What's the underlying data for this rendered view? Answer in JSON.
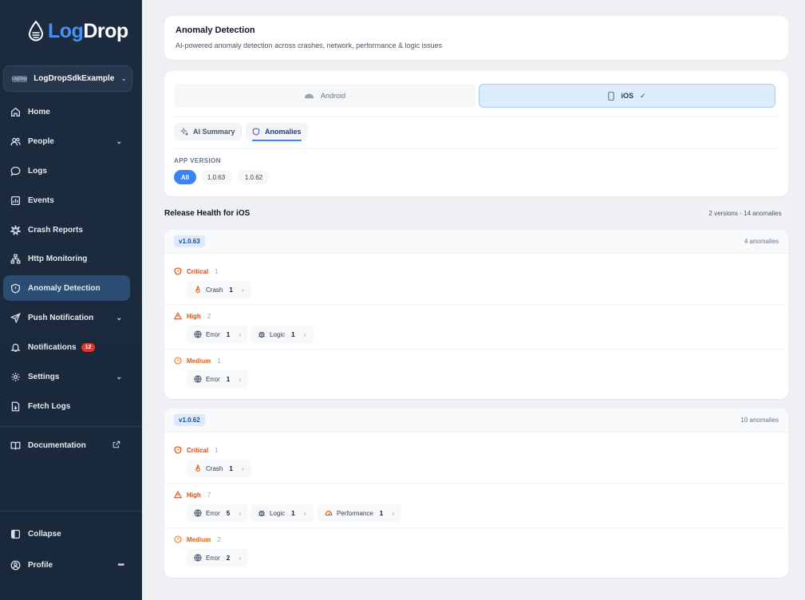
{
  "brand": {
    "part1": "Log",
    "part2": "Drop"
  },
  "project": {
    "icon_text": "LogDrop",
    "name": "LogDropSdkExample"
  },
  "nav": {
    "home": "Home",
    "people": "People",
    "logs": "Logs",
    "events": "Events",
    "crash_reports": "Crash Reports",
    "http_monitoring": "Http Monitoring",
    "anomaly_detection": "Anomaly Detection",
    "push_notification": "Push Notification",
    "notifications": "Notifications",
    "notifications_badge": "12",
    "settings": "Settings",
    "fetch_logs": "Fetch Logs",
    "documentation": "Documentation",
    "collapse": "Collapse",
    "profile": "Profile",
    "more": "•••"
  },
  "header": {
    "title": "Anomaly Detection",
    "subtitle": "AI-powered anomaly detection across crashes, network, performance & logic issues"
  },
  "platforms": {
    "android": "Android",
    "ios": "iOS",
    "ios_check": "✓"
  },
  "tabs": {
    "ai_summary": "AI Summary",
    "anomalies": "Anomalies"
  },
  "app_version": {
    "label": "APP VERSION",
    "options": [
      "All",
      "1.0.63",
      "1.0.62"
    ],
    "selected": "All"
  },
  "release_health": {
    "title": "Release Health for iOS",
    "summary": "2 versions · 14 anomalies"
  },
  "versions": [
    {
      "tag": "v1.0.63",
      "count": "4 anomalies",
      "critical": {
        "label": "Critical",
        "n": "1",
        "items": [
          {
            "label": "Crash",
            "count": "1"
          }
        ]
      },
      "high": {
        "label": "High",
        "n": "2",
        "items": [
          {
            "label": "Error",
            "count": "1"
          },
          {
            "label": "Logic",
            "count": "1"
          }
        ]
      },
      "medium": {
        "label": "Medium",
        "n": "1",
        "items": [
          {
            "label": "Error",
            "count": "1"
          }
        ]
      }
    },
    {
      "tag": "v1.0.62",
      "count": "10 anomalies",
      "critical": {
        "label": "Critical",
        "n": "1",
        "items": [
          {
            "label": "Crash",
            "count": "1"
          }
        ]
      },
      "high": {
        "label": "High",
        "n": "7",
        "items": [
          {
            "label": "Error",
            "count": "5"
          },
          {
            "label": "Logic",
            "count": "1"
          },
          {
            "label": "Performance",
            "count": "1"
          }
        ]
      },
      "medium": {
        "label": "Medium",
        "n": "2",
        "items": [
          {
            "label": "Error",
            "count": "2"
          }
        ]
      }
    }
  ],
  "colors": {
    "sidebar": "#1c2b3f",
    "accent": "#3b82f6",
    "active_nav": "#2b4d72",
    "critical": "#d9480f",
    "badge": "#e5352b"
  }
}
